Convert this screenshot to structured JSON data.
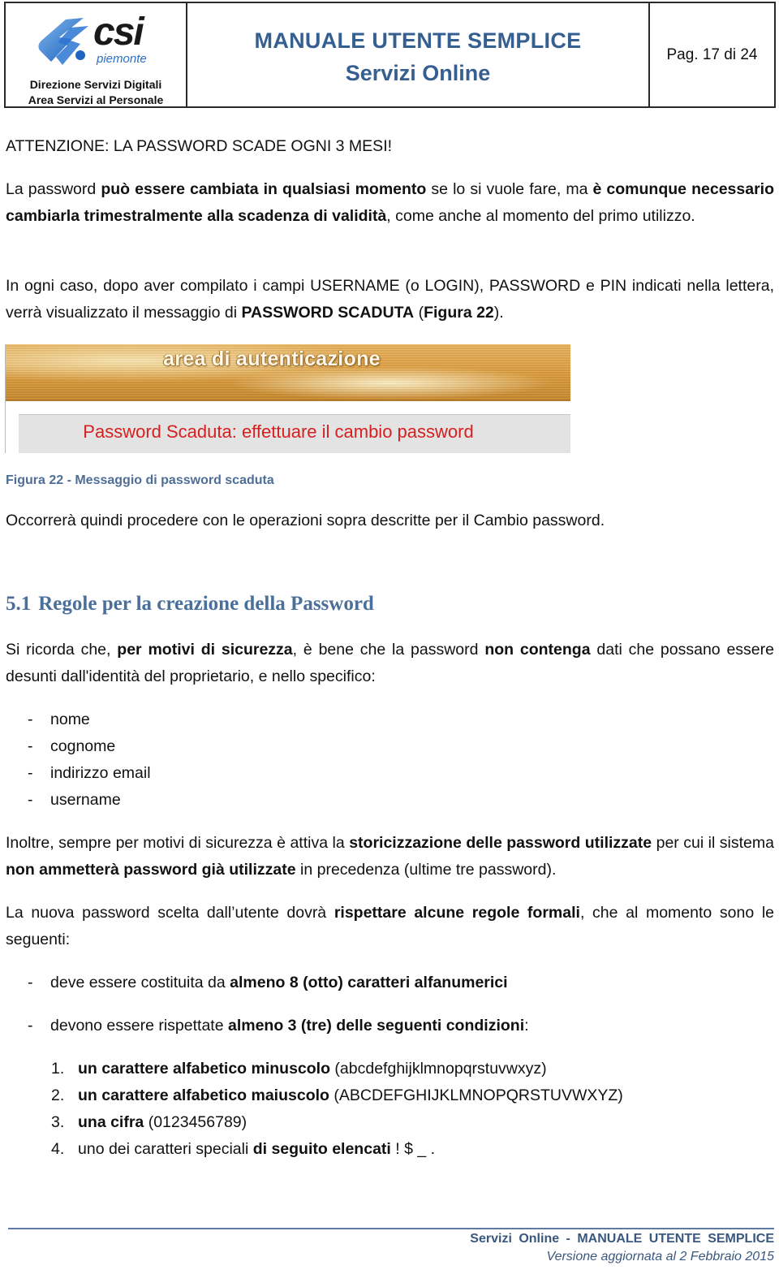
{
  "header": {
    "logo": {
      "brand": "csi",
      "sub": "piemonte",
      "icon": "csi-piemonte-logo-icon"
    },
    "department_line1": "Direzione Servizi Digitali",
    "department_line2": "Area Servizi al Personale",
    "title_line1": "MANUALE UTENTE SEMPLICE",
    "title_line2": "Servizi Online",
    "page_label": "Pag. 17 di 24"
  },
  "warning": "ATTENZIONE: LA PASSWORD SCADE OGNI 3 MESI!",
  "para1": {
    "t1": "La password ",
    "b1": "può essere cambiata in qualsiasi momento",
    "t2": " se lo si vuole fare, ma ",
    "b2": "è comunque necessario cambiarla trimestralmente alla scadenza di validità",
    "t3": ", come anche al momento del primo utilizzo."
  },
  "para2": {
    "t1": "In ogni caso, dopo aver compilato i campi USERNAME (o LOGIN), PASSWORD e PIN indicati nella lettera, verrà visualizzato il messaggio di ",
    "b1": "PASSWORD SCADUTA",
    "t2": " (",
    "b2": "Figura 22",
    "t3": ")."
  },
  "figure": {
    "band_title": "area di autenticazione",
    "message": "Password Scaduta: effettuare il cambio password",
    "caption": "Figura 22 - Messaggio di password scaduta",
    "colors": {
      "band": "#dc9c3c",
      "message_text": "#d62020",
      "message_bg": "#e3e3e3"
    }
  },
  "para3": "Occorrerà quindi procedere con le operazioni sopra descritte per il Cambio password.",
  "section": {
    "number": "5.1",
    "title": "Regole per la creazione della Password"
  },
  "para4": {
    "t1": "Si ricorda che, ",
    "b1": "per motivi di sicurezza",
    "t2": ", è bene che la password ",
    "b2": "non contenga",
    "t3": " dati che possano essere desunti dall'identità del proprietario, e nello specifico:"
  },
  "identity_items": [
    "nome",
    "cognome",
    "indirizzo email",
    "username"
  ],
  "para5": {
    "t1": "Inoltre, sempre per motivi di sicurezza è attiva la ",
    "b1": "storicizzazione delle password utilizzate",
    "t2": " per cui il sistema ",
    "b2": "non ammetterà password già utilizzate",
    "t3": " in precedenza (ultime tre password)."
  },
  "para6": {
    "t1": "La nuova password scelta dall’utente dovrà ",
    "b1": "rispettare alcune regole formali",
    "t2": ", che al momento sono le seguenti:"
  },
  "rules": [
    {
      "t1": "deve essere costituita da ",
      "b1": "almeno 8 (otto) caratteri alfanumerici",
      "t2": ""
    },
    {
      "t1": "devono essere rispettate ",
      "b1": "almeno 3 (tre) delle seguenti condizioni",
      "t2": ":"
    }
  ],
  "conditions": [
    {
      "n": "1.",
      "b": "un carattere alfabetico minuscolo",
      "t": " (abcdefghijklmnopqrstuvwxyz)",
      "pre": ""
    },
    {
      "n": "2.",
      "b": "un carattere alfabetico maiuscolo",
      "t": " (ABCDEFGHIJKLMNOPQRSTUVWXYZ)",
      "pre": ""
    },
    {
      "n": "3.",
      "b": "una cifra",
      "t": " (0123456789)",
      "pre": ""
    },
    {
      "n": "4.",
      "pre": "uno dei caratteri speciali ",
      "b": "di seguito elencati",
      "t": " ! $  _ ."
    }
  ],
  "footer": {
    "line1": "Servizi Online - MANUALE UTENTE SEMPLICE",
    "line2": "Versione aggiornata al 2 Febbraio 2015",
    "rule_color": "#5f7aa0"
  },
  "dash": "-"
}
